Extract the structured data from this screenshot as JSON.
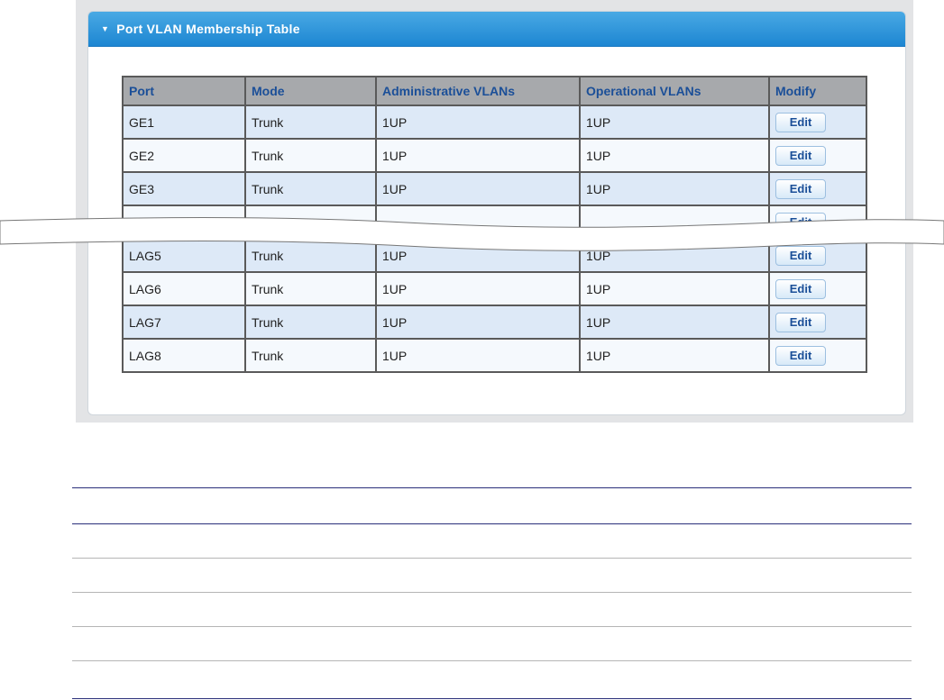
{
  "panel": {
    "title": "Port VLAN Membership Table"
  },
  "table": {
    "headers": [
      "Port",
      "Mode",
      "Administrative VLANs",
      "Operational VLANs",
      "Modify"
    ],
    "rows": [
      {
        "port": "GE1",
        "mode": "Trunk",
        "admin": "1UP",
        "oper": "1UP",
        "action": "Edit"
      },
      {
        "port": "GE2",
        "mode": "Trunk",
        "admin": "1UP",
        "oper": "1UP",
        "action": "Edit"
      },
      {
        "port": "GE3",
        "mode": "Trunk",
        "admin": "1UP",
        "oper": "1UP",
        "action": "Edit"
      },
      {
        "port": "",
        "mode": "",
        "admin": "",
        "oper": "",
        "action": "Edit"
      },
      {
        "port": "LAG5",
        "mode": "Trunk",
        "admin": "1UP",
        "oper": "1UP",
        "action": "Edit"
      },
      {
        "port": "LAG6",
        "mode": "Trunk",
        "admin": "1UP",
        "oper": "1UP",
        "action": "Edit"
      },
      {
        "port": "LAG7",
        "mode": "Trunk",
        "admin": "1UP",
        "oper": "1UP",
        "action": "Edit"
      },
      {
        "port": "LAG8",
        "mode": "Trunk",
        "admin": "1UP",
        "oper": "1UP",
        "action": "Edit"
      }
    ]
  },
  "colors": {
    "header_gradient_top": "#49a9e4",
    "header_gradient_bottom": "#1d86d2",
    "row_odd": "#dde9f7",
    "row_even": "#f5f9fd",
    "header_text": "#1b4f98"
  }
}
